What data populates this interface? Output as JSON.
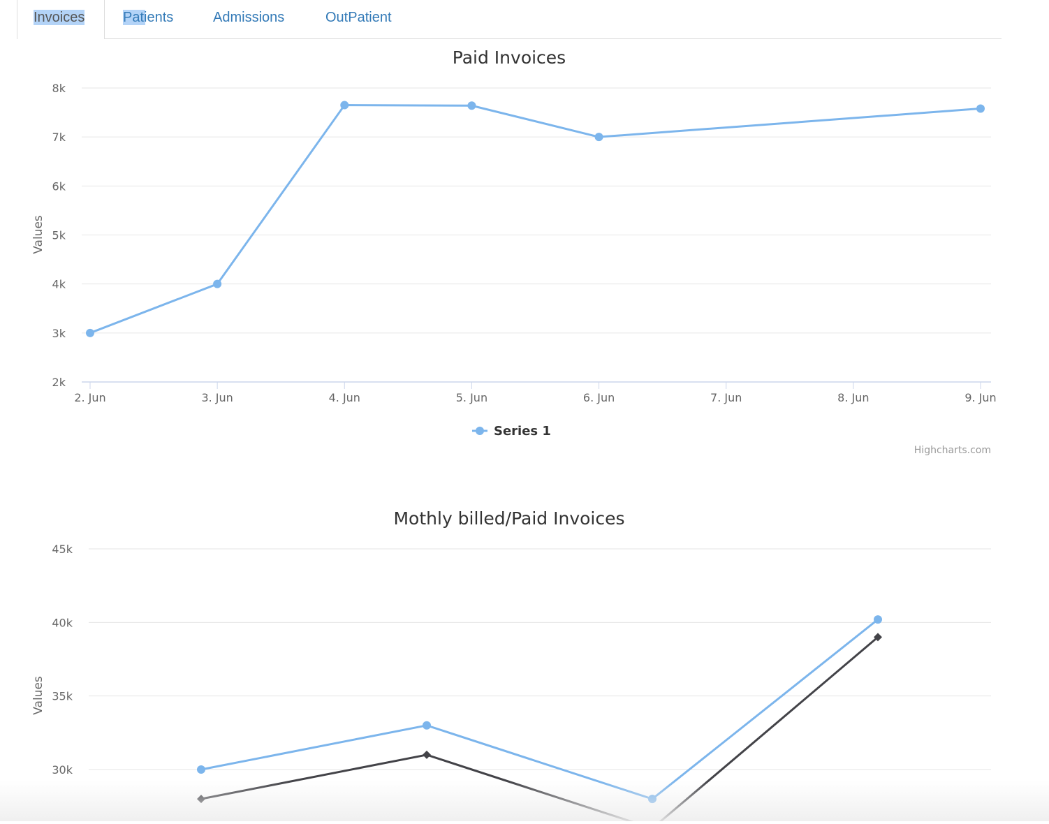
{
  "tabs": [
    {
      "label": "Invoices",
      "active": true
    },
    {
      "label": "Patients",
      "active": false
    },
    {
      "label": "Admissions",
      "active": false
    },
    {
      "label": "OutPatient",
      "active": false
    }
  ],
  "credits": "Highcharts.com",
  "colors": {
    "series1": "#7cb5ec",
    "series2": "#434348",
    "link": "#337ab7",
    "grid": "#e6e6e6"
  },
  "chart_data": [
    {
      "type": "line",
      "title": "Paid Invoices",
      "ylabel": "Values",
      "xlabel": "",
      "ylim": [
        2000,
        8000
      ],
      "yticks": [
        "2k",
        "3k",
        "4k",
        "5k",
        "6k",
        "7k",
        "8k"
      ],
      "categories": [
        "2. Jun",
        "3. Jun",
        "4. Jun",
        "5. Jun",
        "6. Jun",
        "7. Jun",
        "8. Jun",
        "9. Jun"
      ],
      "series": [
        {
          "name": "Series 1",
          "color": "#7cb5ec",
          "marker": "circle",
          "points": [
            {
              "x": "2. Jun",
              "y": 3000
            },
            {
              "x": "3. Jun",
              "y": 4000
            },
            {
              "x": "4. Jun",
              "y": 7650
            },
            {
              "x": "5. Jun",
              "y": 7640
            },
            {
              "x": "6. Jun",
              "y": 7000
            },
            {
              "x": "9. Jun",
              "y": 7580
            }
          ]
        }
      ],
      "legend": "bottom-center"
    },
    {
      "type": "line",
      "title": "Mothly billed/Paid Invoices",
      "ylabel": "Values",
      "xlabel": "",
      "ylim": [
        25000,
        45000
      ],
      "yticks": [
        "30k",
        "35k",
        "40k",
        "45k"
      ],
      "series": [
        {
          "color": "#7cb5ec",
          "marker": "circle",
          "values": [
            30000,
            33000,
            28000,
            40200
          ]
        },
        {
          "color": "#434348",
          "marker": "diamond",
          "values": [
            28000,
            31000,
            26000,
            39000
          ]
        }
      ]
    }
  ]
}
